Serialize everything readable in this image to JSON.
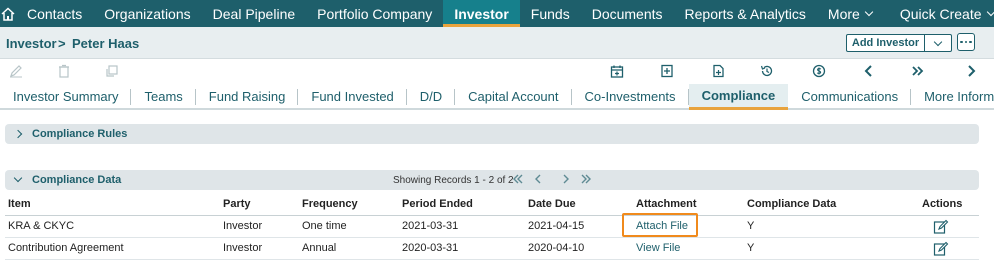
{
  "nav": {
    "items": [
      "Contacts",
      "Organizations",
      "Deal Pipeline",
      "Portfolio Company",
      "Investor",
      "Funds",
      "Documents",
      "Reports & Analytics",
      "More",
      "Quick Create"
    ]
  },
  "breadcrumb": {
    "module": "Investor",
    "separator": ">",
    "record": "Peter Haas"
  },
  "actions": {
    "add_label": "Add Investor"
  },
  "tabs": [
    "Investor Summary",
    "Teams",
    "Fund Raising",
    "Fund Invested",
    "D/D",
    "Capital Account",
    "Co-Investments",
    "Compliance",
    "Communications",
    "More Information"
  ],
  "sections": {
    "rules_title": "Compliance Rules",
    "data_title": "Compliance Data",
    "records_text": "Showing Records 1 - 2 of 2"
  },
  "table": {
    "headers": [
      "Item",
      "Party",
      "Frequency",
      "Period Ended",
      "Date Due",
      "Attachment",
      "Compliance Data",
      "Actions"
    ],
    "rows": [
      {
        "item": "KRA & CKYC",
        "party": "Investor",
        "frequency": "One time",
        "period_ended": "2021-03-31",
        "date_due": "2021-04-15",
        "attachment": "Attach File",
        "compliance": "Y"
      },
      {
        "item": "Contribution Agreement",
        "party": "Investor",
        "frequency": "Annual",
        "period_ended": "2020-03-31",
        "date_due": "2020-04-10",
        "attachment": "View File",
        "compliance": "Y"
      }
    ]
  },
  "colors": {
    "nav_bg": "#1e5f6b",
    "accent": "#e8a33d",
    "highlight": "#f08a1c"
  }
}
